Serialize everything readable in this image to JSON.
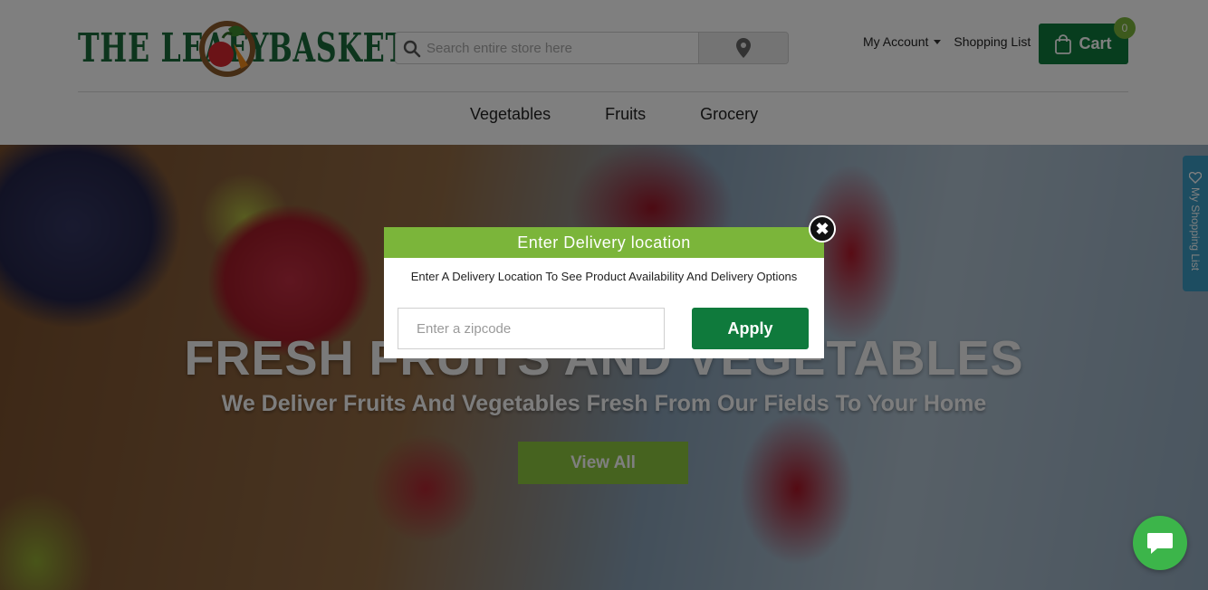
{
  "header": {
    "logo": {
      "left": "THE LEAFY",
      "right": "BASKET"
    },
    "search": {
      "placeholder": "Search entire store here"
    },
    "account_label": "My Account",
    "shopping_list_label": "Shopping List",
    "cart_label": "Cart",
    "cart_count": "0"
  },
  "nav": {
    "items": [
      "Vegetables",
      "Fruits",
      "Grocery"
    ]
  },
  "hero": {
    "title": "FRESH FRUITS AND VEGETABLES",
    "subtitle": "We Deliver Fruits And Vegetables Fresh From Our Fields To Your Home",
    "cta_label": "View All"
  },
  "side_tab": {
    "label": "My Shopping List"
  },
  "modal": {
    "title": "Enter Delivery location",
    "description": "Enter A Delivery Location To See Product Availability And Delivery Options",
    "zip_placeholder": "Enter a zipcode",
    "apply_label": "Apply",
    "close_symbol": "✖"
  },
  "colors": {
    "brand_green": "#0f7a3c",
    "accent_green": "#7bb53a",
    "side_tab_blue": "#3a9bc2",
    "chat_green": "#3cb54a"
  },
  "icons": {
    "search": "search-icon",
    "location": "map-pin-icon",
    "cart": "shopping-bag-icon",
    "side_tab": "heart-icon",
    "chat": "chat-bubble-icon",
    "close": "close-icon",
    "account": "chevron-down-icon"
  }
}
